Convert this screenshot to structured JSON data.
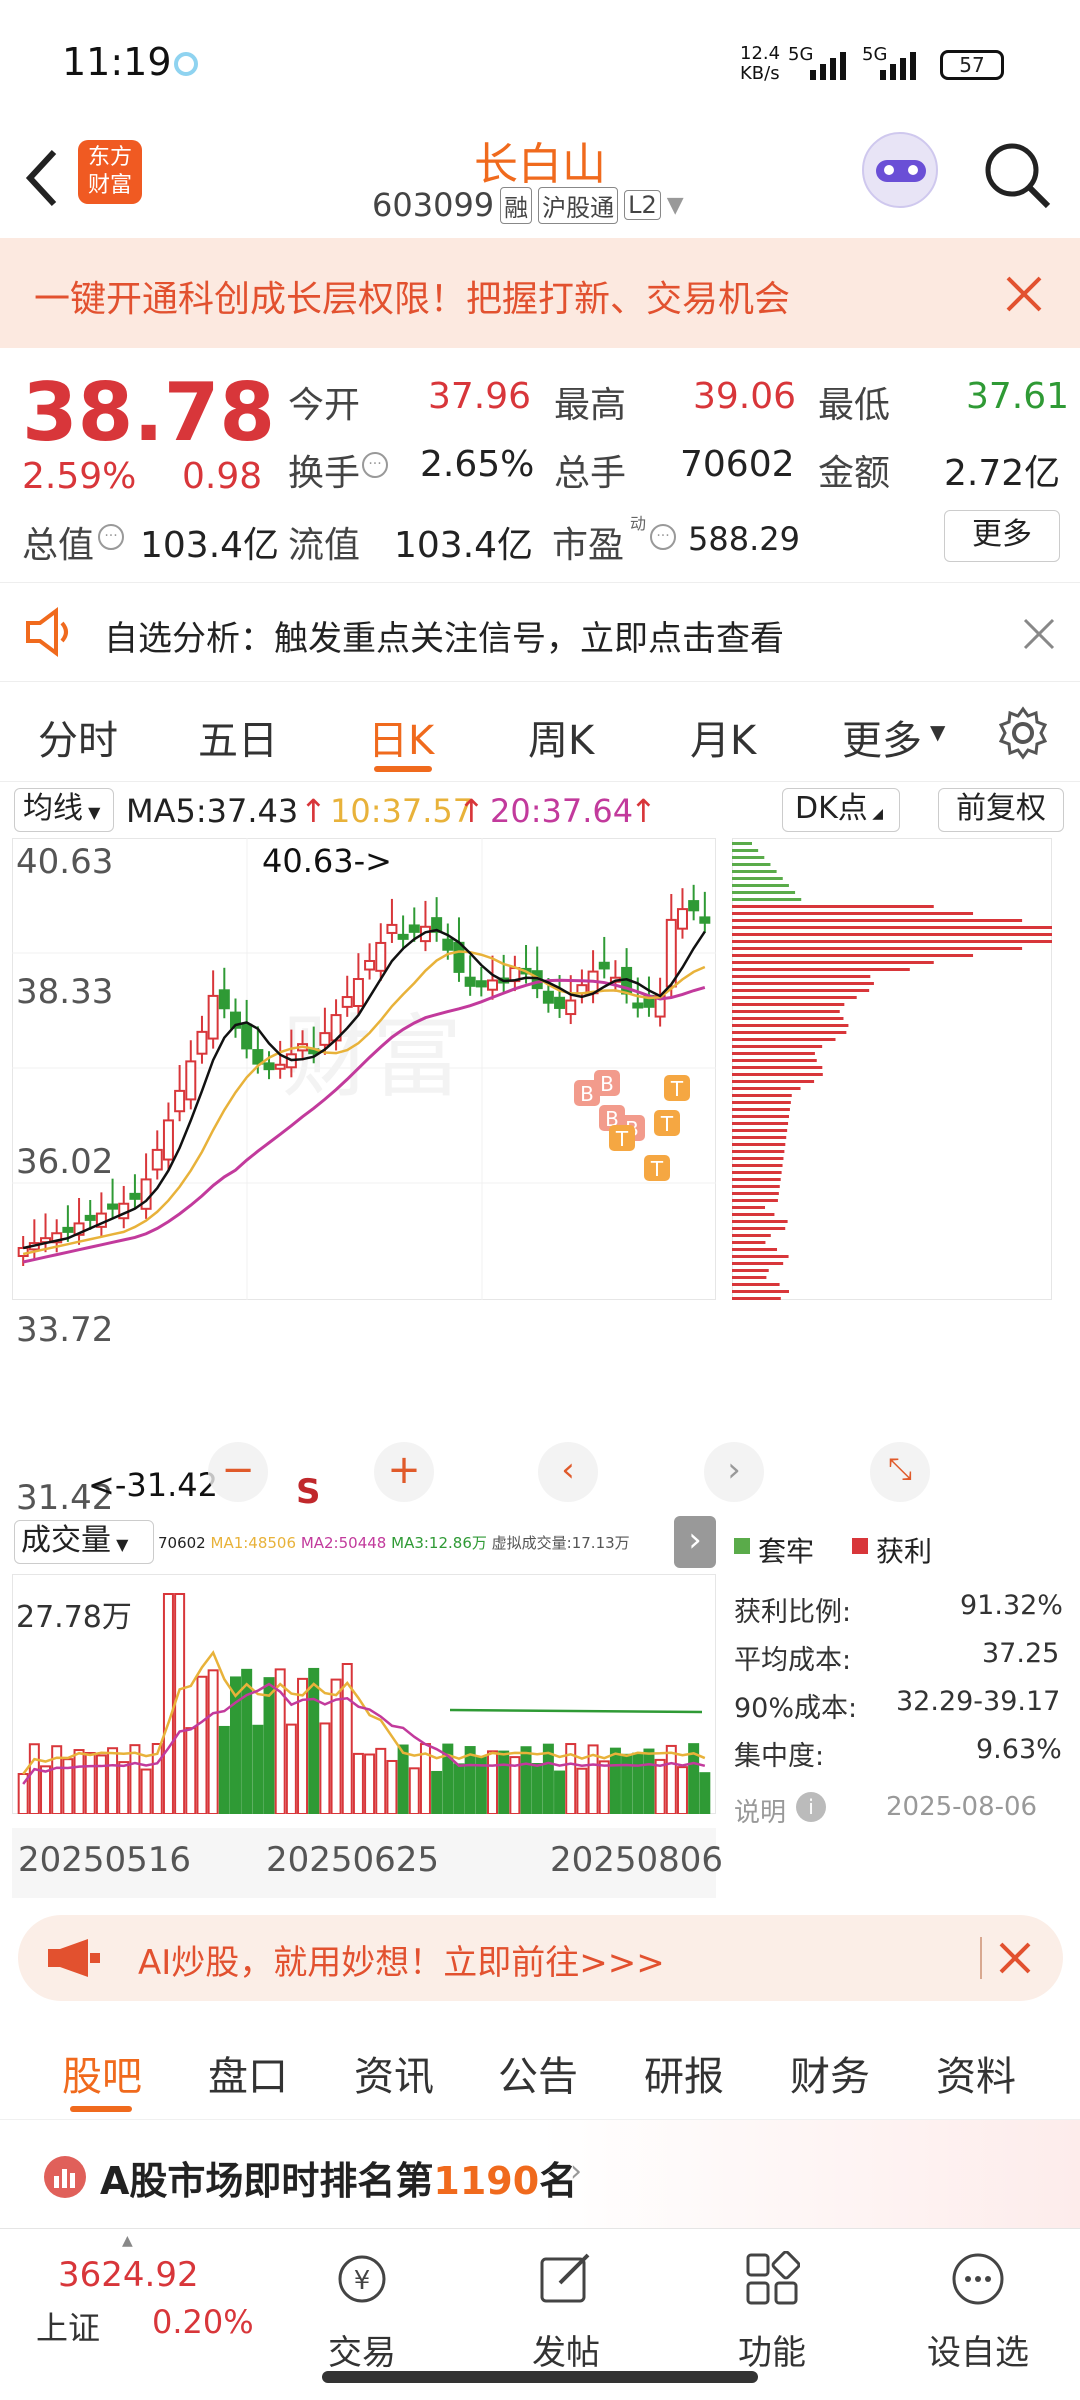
{
  "status": {
    "time": "11:19",
    "net_speed": "12.4",
    "net_unit": "KB/s",
    "net1": "5G",
    "net2": "5G",
    "battery": "57"
  },
  "header": {
    "title": "长白山",
    "code": "603099",
    "tag_margin": "融",
    "tag_hk": "沪股通",
    "tag_l2": "L2",
    "logo_text1": "东方",
    "logo_text2": "财富"
  },
  "banner": {
    "text": "一键开通科创成长层权限！把握打新、交易机会"
  },
  "quote": {
    "price": "38.78",
    "change_pct": "2.59%",
    "change": "0.98",
    "open_label": "今开",
    "open": "37.96",
    "high_label": "最高",
    "high": "39.06",
    "low_label": "最低",
    "low": "37.61",
    "turnover_label": "换手",
    "turnover": "2.65%",
    "volume_label": "总手",
    "volume": "70602",
    "amount_label": "金额",
    "amount": "2.72亿",
    "mktcap_label": "总值",
    "mktcap": "103.4亿",
    "float_label": "流值",
    "float": "103.4亿",
    "pe_label": "市盈",
    "pe_sup": "动",
    "pe": "588.29",
    "more": "更多"
  },
  "alert": {
    "text": "自选分析：触发重点关注信号，立即点击查看"
  },
  "tabs": [
    "分时",
    "五日",
    "日K",
    "周K",
    "月K",
    "更多"
  ],
  "chart": {
    "ma_select": "均线",
    "ma5": "MA5:37.43",
    "ma10": "10:37.57",
    "ma20": "20:37.64",
    "dk": "DK点",
    "fq": "前复权",
    "y_labels": [
      "40.63",
      "38.33",
      "36.02",
      "33.72",
      "31.42"
    ],
    "high_note": "40.63->",
    "low_note": "<-31.42",
    "vol_select": "成交量",
    "vol_line": "70602",
    "vol_ma1": "MA1:48506",
    "vol_ma2": "MA2:50448",
    "vol_ma3": "MA3:12.86万",
    "vol_virtual": "虚拟成交量:17.13万",
    "vol_max": "27.78万",
    "dates": [
      "20250516",
      "20250625",
      "20250806"
    ],
    "s_mark": "S",
    "legend_trap": "套牢",
    "legend_profit": "获利",
    "chip_stats": [
      {
        "label": "获利比例:",
        "value": "91.32%"
      },
      {
        "label": "平均成本:",
        "value": "37.25"
      },
      {
        "label": "90%成本:",
        "value": "32.29-39.17"
      },
      {
        "label": "集中度:",
        "value": "9.63%"
      }
    ],
    "note_label": "说明",
    "date": "2025-08-06"
  },
  "ai_banner": {
    "text": "AI炒股，就用妙想！立即前往>>>"
  },
  "footer_tabs": [
    "股吧",
    "盘口",
    "资讯",
    "公告",
    "研报",
    "财务",
    "资料"
  ],
  "rank": {
    "prefix": "A股市场即时排名第",
    "num": "1190",
    "suffix": "名"
  },
  "bottom_nav": {
    "index_value": "3624.92",
    "index_name": "上证",
    "index_change": "0.20%",
    "items": [
      "交易",
      "发帖",
      "功能",
      "设自选"
    ]
  },
  "colors": {
    "up": "#d8363a",
    "down": "#2f9a35",
    "accent": "#f06a1d"
  }
}
